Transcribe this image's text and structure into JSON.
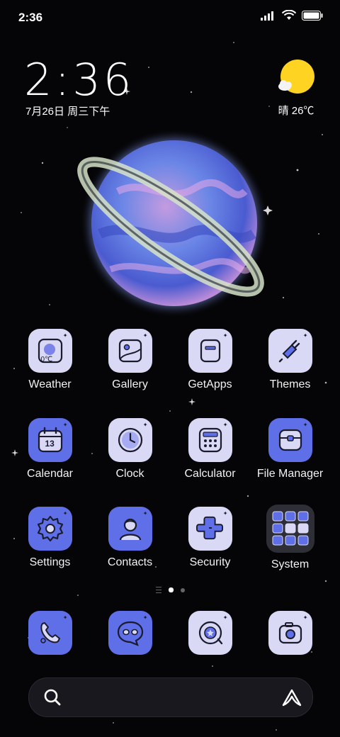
{
  "status_bar": {
    "time": "2:36",
    "icons": [
      "signal-icon",
      "wifi-icon",
      "battery-icon"
    ]
  },
  "clock_widget": {
    "time": "2:36",
    "date": "7月26日 周三下午"
  },
  "weather_widget": {
    "text": "晴 26℃",
    "icon": "sun-cloud-icon"
  },
  "apps": [
    {
      "label": "Weather",
      "icon": "weather-icon",
      "style": "light",
      "sub": "0℃"
    },
    {
      "label": "Gallery",
      "icon": "gallery-icon",
      "style": "light"
    },
    {
      "label": "GetApps",
      "icon": "getapps-icon",
      "style": "light"
    },
    {
      "label": "Themes",
      "icon": "themes-icon",
      "style": "light"
    },
    {
      "label": "Calendar",
      "icon": "calendar-icon",
      "style": "blue",
      "sub": "13"
    },
    {
      "label": "Clock",
      "icon": "clock-icon",
      "style": "light"
    },
    {
      "label": "Calculator",
      "icon": "calculator-icon",
      "style": "light"
    },
    {
      "label": "File Manager",
      "icon": "file-manager-icon",
      "style": "blue"
    },
    {
      "label": "Settings",
      "icon": "settings-icon",
      "style": "blue"
    },
    {
      "label": "Contacts",
      "icon": "contacts-icon",
      "style": "blue"
    },
    {
      "label": "Security",
      "icon": "security-icon",
      "style": "light"
    },
    {
      "label": "System",
      "icon": "folder-icon",
      "style": "dark"
    }
  ],
  "page_indicator": {
    "pages": 2,
    "active": 1
  },
  "dock": [
    {
      "icon": "phone-icon",
      "style": "blue"
    },
    {
      "icon": "messages-icon",
      "style": "blue"
    },
    {
      "icon": "browser-icon",
      "style": "light"
    },
    {
      "icon": "camera-icon",
      "style": "light"
    }
  ],
  "search_bar": {
    "left_icon": "search-icon",
    "right_icon": "assistant-icon"
  }
}
